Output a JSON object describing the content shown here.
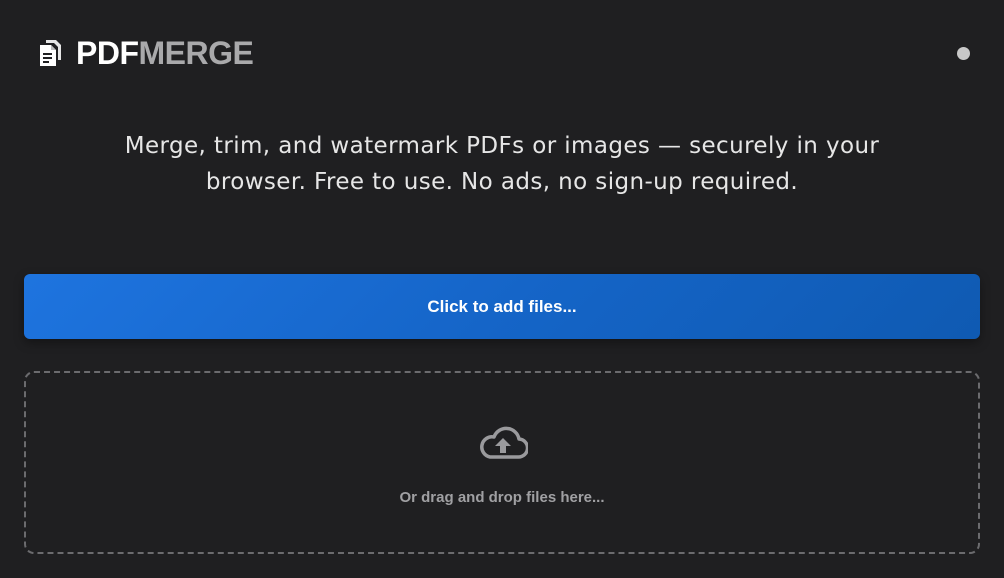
{
  "header": {
    "logo_icon": "document-stack-icon",
    "logo_part1": "PDF",
    "logo_part2": "MERGE",
    "status_indicator": "status-dot"
  },
  "tagline": {
    "line1": "Merge, trim, and watermark PDFs or images — securely in your",
    "line2": "browser. Free to use. No ads, no sign-up required."
  },
  "actions": {
    "add_files_label": "Click to add files..."
  },
  "dropzone": {
    "icon": "cloud-upload-icon",
    "text": "Or drag and drop files here..."
  },
  "colors": {
    "background": "#1f1f21",
    "accent": "#1a6dd4",
    "logo_secondary": "#a9a9ab"
  }
}
